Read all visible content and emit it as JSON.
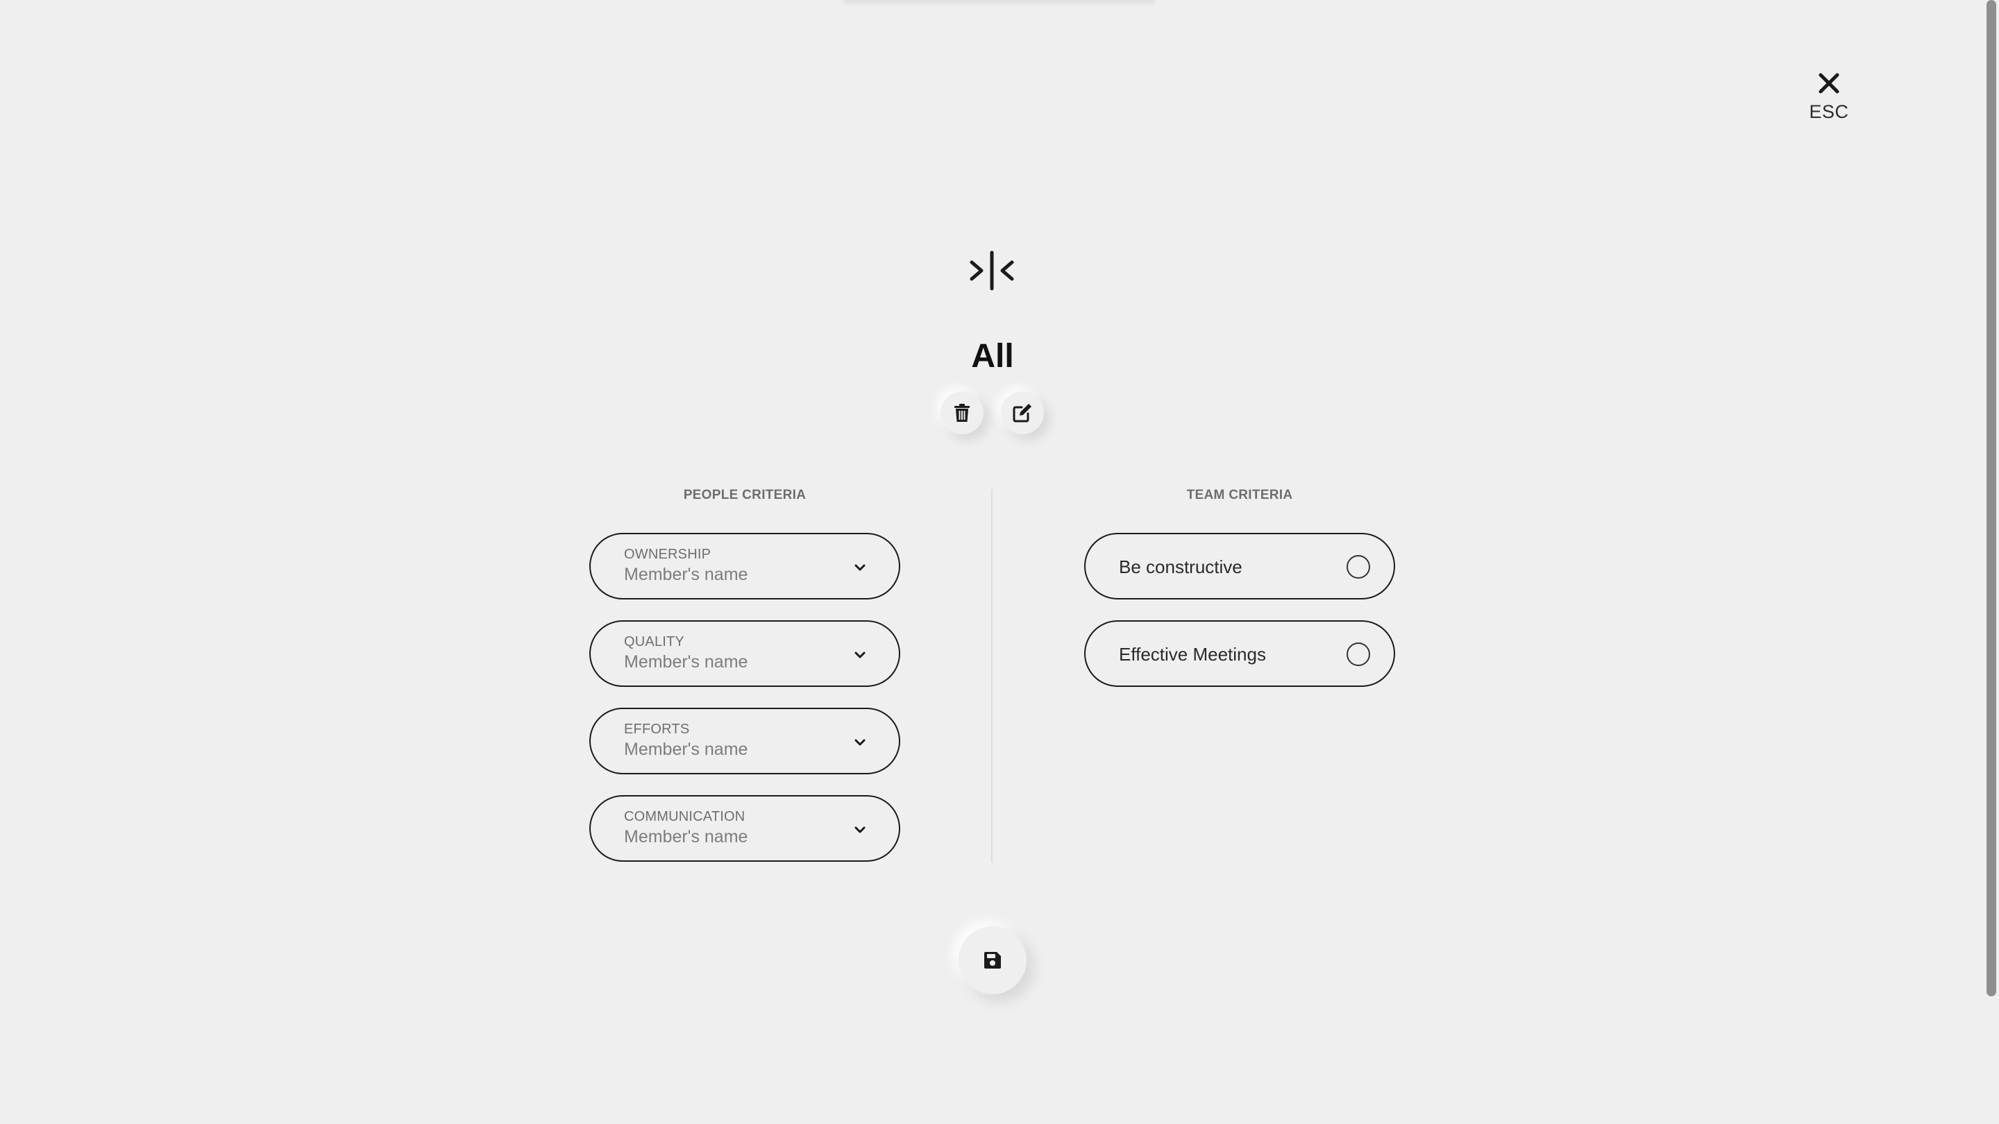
{
  "header": {
    "close_label": "ESC",
    "close_icon": "close-icon",
    "logo_icon": "brand-logo-icon"
  },
  "title": "All",
  "actions": {
    "delete_icon": "trash-icon",
    "edit_icon": "edit-icon"
  },
  "people_criteria": {
    "heading": "PEOPLE CRITERIA",
    "items": [
      {
        "label": "OWNERSHIP",
        "placeholder": "Member's name"
      },
      {
        "label": "QUALITY",
        "placeholder": "Member's name"
      },
      {
        "label": "EFFORTS",
        "placeholder": "Member's name"
      },
      {
        "label": "COMMUNICATION",
        "placeholder": "Member's name"
      }
    ]
  },
  "team_criteria": {
    "heading": "TEAM CRITERIA",
    "items": [
      {
        "label": "Be constructive",
        "selected": false
      },
      {
        "label": "Effective Meetings",
        "selected": false
      }
    ]
  },
  "save": {
    "icon": "save-icon"
  },
  "colors": {
    "background": "#efefef",
    "border": "#1b1b1b",
    "muted_text": "#6e6e6e"
  }
}
